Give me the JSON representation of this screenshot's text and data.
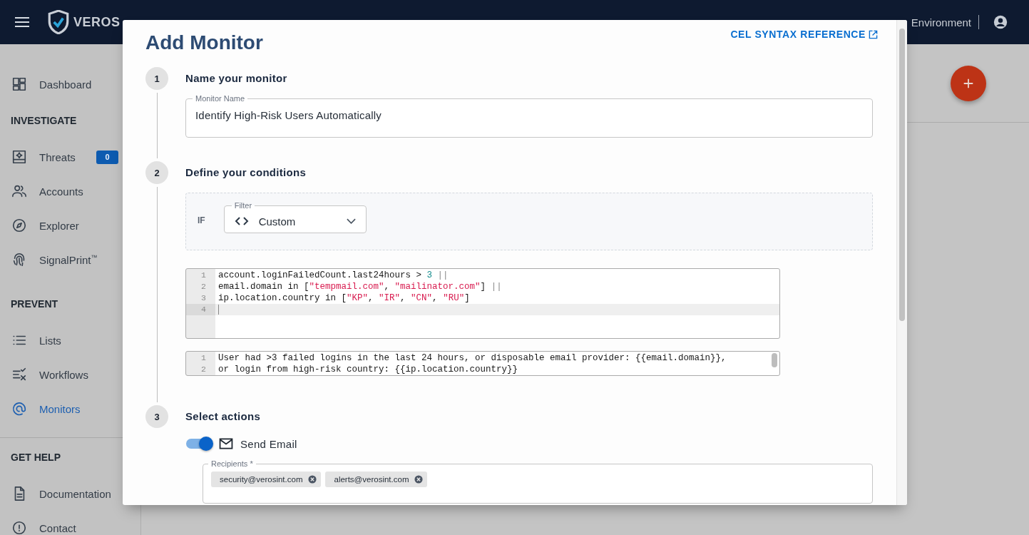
{
  "header": {
    "brand": "VEROS",
    "environment": "Environment"
  },
  "sidebar": {
    "sections": [
      {
        "items": [
          {
            "label": "Dashboard",
            "kind": "dashboard",
            "selected": false
          }
        ]
      },
      {
        "heading": "INVESTIGATE",
        "items": [
          {
            "label": "Threats",
            "kind": "threats",
            "selected": false,
            "badge": "0"
          },
          {
            "label": "Accounts",
            "kind": "accounts",
            "selected": false
          },
          {
            "label": "Explorer",
            "kind": "explorer",
            "selected": false
          },
          {
            "label": "SignalPrint$^{™}$",
            "kind": "fingerprint",
            "selected": false
          }
        ]
      },
      {
        "heading": "PREVENT",
        "items": [
          {
            "label": "Lists",
            "kind": "lists",
            "selected": false
          },
          {
            "label": "Workflows",
            "kind": "workflows",
            "selected": false
          },
          {
            "label": "Monitors",
            "kind": "monitors",
            "selected": true
          }
        ]
      },
      {
        "heading": "GET HELP",
        "divider_above": true,
        "items": [
          {
            "label": "Documentation",
            "kind": "document",
            "selected": false
          },
          {
            "label": "Contact",
            "kind": "contact",
            "selected": false
          }
        ]
      }
    ]
  },
  "modal": {
    "title": "Add Monitor",
    "link": "CEL SYNTAX REFERENCE",
    "steps": [
      {
        "number": "1",
        "title": "Name your monitor",
        "kind": "name",
        "field": {
          "label": "Monitor Name",
          "value": "Identify High-Risk Users Automatically"
        }
      },
      {
        "number": "2",
        "title": "Define your conditions",
        "kind": "conditions",
        "condition_label": "IF",
        "filter": {
          "label": "Filter",
          "value": "Custom"
        },
        "expression": [
          {
            "number": "1",
            "current": false,
            "tokens": [
              {
                "text": "account.loginFailedCount.last24hours > ",
                "kind": "plain"
              },
              {
                "text": "3",
                "kind": "number"
              },
              {
                "text": " ||",
                "kind": "operator"
              }
            ]
          },
          {
            "number": "2",
            "current": false,
            "tokens": [
              {
                "text": "email.domain in [",
                "kind": "plain"
              },
              {
                "text": "\"tempmail.com\"",
                "kind": "string"
              },
              {
                "text": ", ",
                "kind": "plain"
              },
              {
                "text": "\"mailinator.com\"",
                "kind": "string"
              },
              {
                "text": "] ",
                "kind": "plain"
              },
              {
                "text": "||",
                "kind": "operator"
              }
            ]
          },
          {
            "number": "3",
            "current": false,
            "tokens": [
              {
                "text": "ip.location.country in [",
                "kind": "plain"
              },
              {
                "text": "\"KP\"",
                "kind": "string"
              },
              {
                "text": ", ",
                "kind": "plain"
              },
              {
                "text": "\"IR\"",
                "kind": "string"
              },
              {
                "text": ", ",
                "kind": "plain"
              },
              {
                "text": "\"CN\"",
                "kind": "string"
              },
              {
                "text": ", ",
                "kind": "plain"
              },
              {
                "text": "\"RU\"",
                "kind": "string"
              },
              {
                "text": "]",
                "kind": "plain"
              }
            ]
          },
          {
            "number": "4",
            "current": true
          }
        ],
        "message": [
          {
            "number": "1",
            "text": "User had >3 failed logins in the last 24 hours, or disposable email provider: {{email.domain}},"
          },
          {
            "number": "2",
            "text": "or login from high-risk country: {{ip.location.country}}"
          }
        ]
      },
      {
        "number": "3",
        "title": "Select actions",
        "kind": "actions",
        "actions": [
          {
            "label": "Send Email",
            "on": true,
            "recipients": {
              "label": "Recipients *",
              "chips": [
                "security@verosint.com",
                "alerts@verosint.com"
              ]
            }
          }
        ]
      }
    ]
  }
}
